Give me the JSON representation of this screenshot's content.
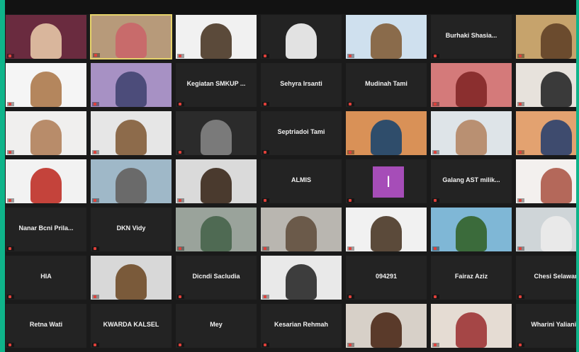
{
  "window": {
    "title": ""
  },
  "colors": {
    "accent": "#0fb48a",
    "active_border": "#e6d36a",
    "avatar_purple": "#a64db8",
    "mic_muted": "#e0403a"
  },
  "participants": [
    {
      "name": "",
      "label": "",
      "video": true,
      "bg": "#6a2b3f",
      "fg": "#d9b69c"
    },
    {
      "name": "",
      "label": "",
      "video": true,
      "bg": "#b79a7a",
      "fg": "#c86b6b",
      "active": true
    },
    {
      "name": "",
      "label": "",
      "video": true,
      "bg": "#f1f1f1",
      "fg": "#5b4a3a"
    },
    {
      "name": "",
      "label": "",
      "video": true,
      "bg": "#232323",
      "fg": "#e2e2e2"
    },
    {
      "name": "",
      "label": "",
      "video": true,
      "bg": "#cfe0ee",
      "fg": "#8a6b4b"
    },
    {
      "name": "Burhaki Shasia...",
      "label": "",
      "video": false
    },
    {
      "name": "",
      "label": "",
      "video": true,
      "bg": "#c6a36c",
      "fg": "#6b4b2e"
    },
    {
      "name": "",
      "label": "",
      "video": true,
      "bg": "#f5f5f5",
      "fg": "#b4865d"
    },
    {
      "name": "",
      "label": "",
      "video": true,
      "bg": "#a791c4",
      "fg": "#4c4c7a"
    },
    {
      "name": "Kegiatan SMKUP ...",
      "label": "",
      "video": false
    },
    {
      "name": "Sehyra Irsanti",
      "label": "",
      "video": false
    },
    {
      "name": "Mudinah Tami",
      "label": "",
      "video": false
    },
    {
      "name": "",
      "label": "",
      "video": true,
      "bg": "#d47a7a",
      "fg": "#8b2f2f"
    },
    {
      "name": "",
      "label": "",
      "video": true,
      "bg": "#e7e2dc",
      "fg": "#3a3a3a"
    },
    {
      "name": "",
      "label": "",
      "video": true,
      "bg": "#f0efee",
      "fg": "#b88c6a"
    },
    {
      "name": "",
      "label": "",
      "video": true,
      "bg": "#e6e6e6",
      "fg": "#8d6b4b"
    },
    {
      "name": "",
      "label": "",
      "video": true,
      "bg": "#2b2b2b",
      "fg": "#7a7a7a"
    },
    {
      "name": "Septriadoi Tami",
      "label": "",
      "video": false
    },
    {
      "name": "",
      "label": "",
      "video": true,
      "bg": "#d99157",
      "fg": "#2f4d6b"
    },
    {
      "name": "",
      "label": "",
      "video": true,
      "bg": "#dee4e8",
      "fg": "#b99072"
    },
    {
      "name": "",
      "label": "",
      "video": true,
      "bg": "#e3a270",
      "fg": "#3e4b6e"
    },
    {
      "name": "",
      "label": "",
      "video": true,
      "bg": "#f2f2f2",
      "fg": "#c4433b"
    },
    {
      "name": "",
      "label": "",
      "video": true,
      "bg": "#9fb8c8",
      "fg": "#6a6a6a"
    },
    {
      "name": "",
      "label": "",
      "video": true,
      "bg": "#dadada",
      "fg": "#4a3a2e"
    },
    {
      "name": "ALMIS",
      "label": "",
      "video": false
    },
    {
      "name": "",
      "label": "",
      "video": false,
      "avatar": "I"
    },
    {
      "name": "Galang AST milik...",
      "label": "",
      "video": false
    },
    {
      "name": "",
      "label": "",
      "video": true,
      "bg": "#f3f0ee",
      "fg": "#b4685a"
    },
    {
      "name": "Nanar Bcni Prila...",
      "label": "",
      "video": false
    },
    {
      "name": "DKN Vidy",
      "label": "",
      "video": false
    },
    {
      "name": "",
      "label": "",
      "video": true,
      "bg": "#9aa39b",
      "fg": "#4f6a53"
    },
    {
      "name": "",
      "label": "",
      "video": true,
      "bg": "#b9b6b0",
      "fg": "#6b5a4a"
    },
    {
      "name": "",
      "label": "",
      "video": true,
      "bg": "#f1f1f1",
      "fg": "#5b4a3a"
    },
    {
      "name": "",
      "label": "",
      "video": true,
      "bg": "#7fb7d6",
      "fg": "#3b6b3b"
    },
    {
      "name": "",
      "label": "",
      "video": true,
      "bg": "#cfd5d8",
      "fg": "#e9e9e9"
    },
    {
      "name": "HIA",
      "label": "",
      "video": false
    },
    {
      "name": "",
      "label": "",
      "video": true,
      "bg": "#d8d8d8",
      "fg": "#7a5a3a"
    },
    {
      "name": "Dicndi Sacludia",
      "label": "",
      "video": false
    },
    {
      "name": "",
      "label": "",
      "video": true,
      "bg": "#e9e9e9",
      "fg": "#3d3d3d"
    },
    {
      "name": "094291",
      "label": "",
      "video": false
    },
    {
      "name": "Fairaz Aziz",
      "label": "",
      "video": false
    },
    {
      "name": "Chesi Selawan",
      "label": "",
      "video": false
    },
    {
      "name": "Retna Wati",
      "label": "",
      "video": false
    },
    {
      "name": "KWARDA KALSEL",
      "label": "",
      "video": false
    },
    {
      "name": "Mey",
      "label": "",
      "video": false
    },
    {
      "name": "Kesarian Rehmah",
      "label": "",
      "video": false
    },
    {
      "name": "",
      "label": "",
      "video": true,
      "bg": "#d7d0c8",
      "fg": "#5a3a2a"
    },
    {
      "name": "",
      "label": "",
      "video": true,
      "bg": "#e5dcd3",
      "fg": "#a54646"
    },
    {
      "name": "Wharini Yaliani...",
      "label": "",
      "video": false
    }
  ]
}
